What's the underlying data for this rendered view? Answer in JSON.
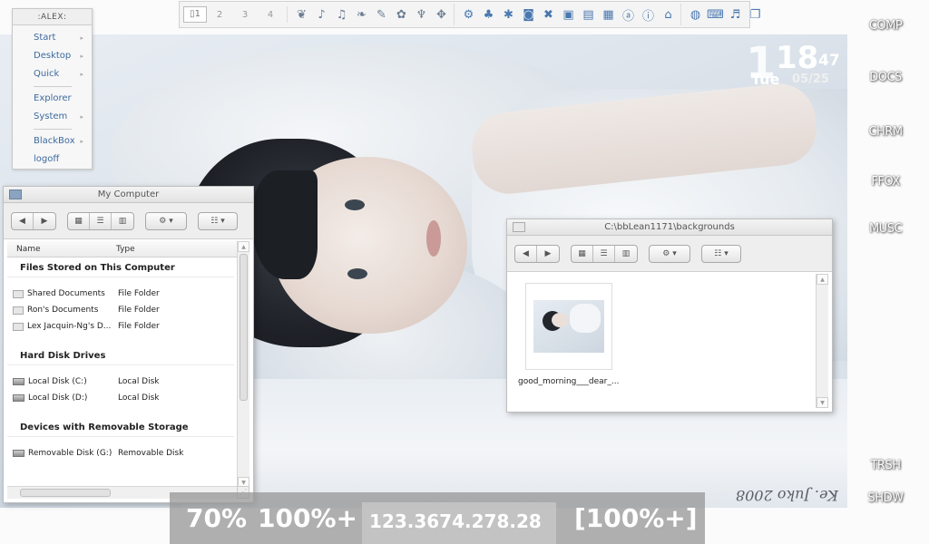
{
  "menu": {
    "title": ":ALEX:",
    "items": [
      {
        "label": "Start",
        "arrow": "▸"
      },
      {
        "label": "Desktop",
        "arrow": "▸"
      },
      {
        "label": "Quick",
        "arrow": "▸"
      },
      {
        "label": "Explorer",
        "arrow": ""
      },
      {
        "label": "System",
        "arrow": "▸"
      },
      {
        "label": "BlackBox",
        "arrow": "▸"
      },
      {
        "label": "logoff",
        "arrow": ""
      }
    ]
  },
  "toolbar": {
    "workspaces": [
      "1",
      "2",
      "3",
      "4"
    ],
    "workspace_icon": "workspace-grid-icon",
    "tray_icons_a": [
      "ribbon-icon",
      "ribbon-icon",
      "ribbon-icon",
      "ribbon-icon",
      "ribbon-icon",
      "ribbon-icon",
      "ribbon-icon",
      "ribbon-icon"
    ],
    "tray_icons_b": [
      "network-icon",
      "users-icon",
      "bluetooth-icon",
      "wireless-icon",
      "firewall-icon",
      "monitor-icon",
      "display-icon",
      "screen-icon",
      "info-icon",
      "info-icon",
      "home-icon"
    ],
    "tray_icons_c": [
      "globe-icon",
      "keyboard-icon",
      "volume-icon",
      "window-icon"
    ]
  },
  "clock": {
    "hour": "1",
    "minutes": "18",
    "seconds": "47",
    "weekday": "Tue",
    "date": "05/25"
  },
  "side_labels": [
    "COMP",
    "DOCS",
    "CHRM",
    "FFOX",
    "MUSC",
    "TRSH",
    "SHDW"
  ],
  "my_computer": {
    "title": "My Computer",
    "columns": [
      "Name",
      "Type"
    ],
    "groups": [
      {
        "heading": "Files Stored on This Computer",
        "rows": [
          {
            "name": "Shared Documents",
            "type": "File Folder",
            "icon": "folder-icon"
          },
          {
            "name": "Ron's Documents",
            "type": "File Folder",
            "icon": "folder-icon"
          },
          {
            "name": "Lex Jacquin-Ng's D...",
            "type": "File Folder",
            "icon": "folder-icon"
          }
        ]
      },
      {
        "heading": "Hard Disk Drives",
        "rows": [
          {
            "name": "Local Disk (C:)",
            "type": "Local Disk",
            "icon": "drive-icon"
          },
          {
            "name": "Local Disk (D:)",
            "type": "Local Disk",
            "icon": "drive-icon"
          }
        ]
      },
      {
        "heading": "Devices with Removable Storage",
        "rows": [
          {
            "name": "Removable Disk (G:)",
            "type": "Removable Disk",
            "icon": "drive-icon"
          }
        ]
      }
    ]
  },
  "backgrounds_window": {
    "title": "C:\\bbLean1171\\backgrounds",
    "file_caption": "good_morning___dear_..."
  },
  "status_bar": {
    "cpu": "70%",
    "mem": "100%+",
    "ip": "123.3674.278.28",
    "battery": "[100%+]"
  },
  "wallpaper_signature": "Ke. Juko 2008"
}
